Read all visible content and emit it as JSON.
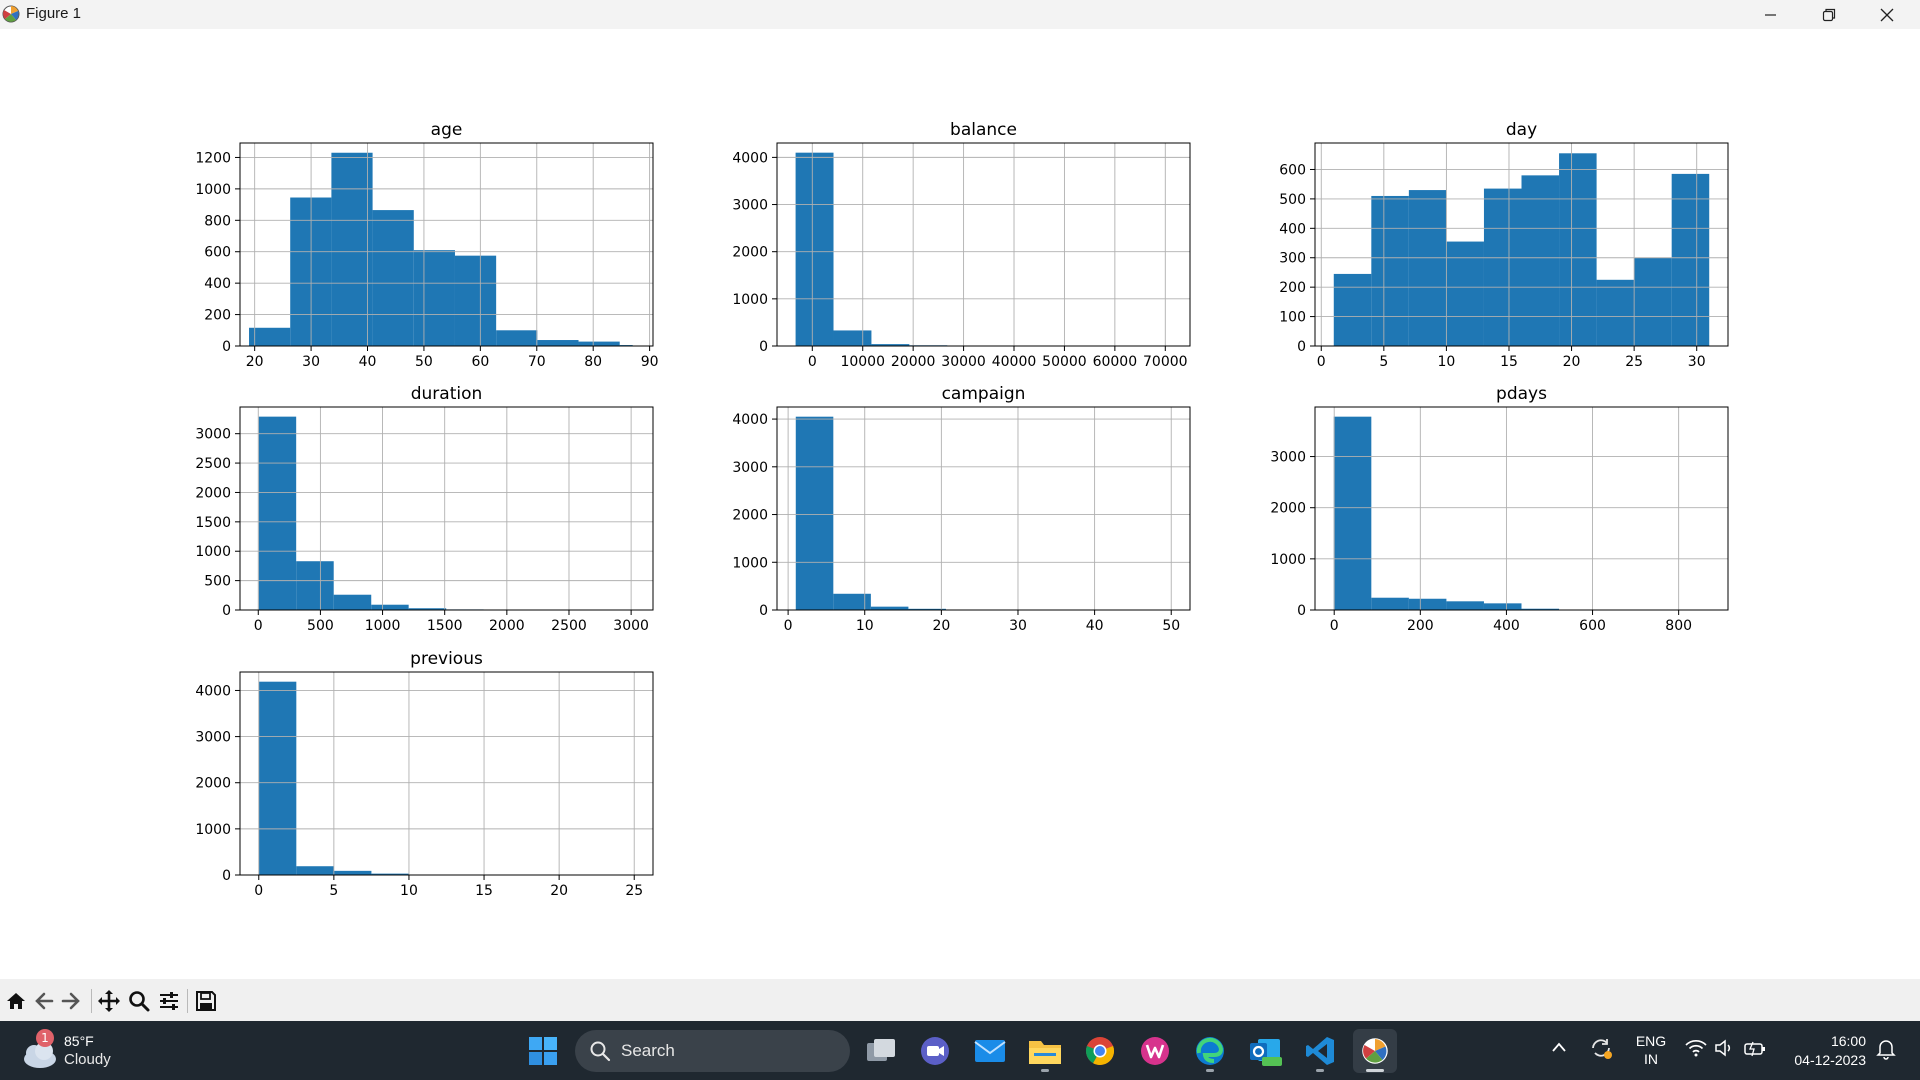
{
  "window": {
    "title": "Figure 1",
    "controls": [
      "minimize",
      "restore",
      "close"
    ]
  },
  "toolbar": {
    "buttons": [
      {
        "name": "home-icon"
      },
      {
        "name": "back-arrow-icon"
      },
      {
        "name": "forward-arrow-icon"
      },
      {
        "name": "pan-icon"
      },
      {
        "name": "zoom-icon"
      },
      {
        "name": "configure-subplots-icon"
      },
      {
        "name": "save-icon"
      }
    ]
  },
  "colors": {
    "bar": "#1f77b4",
    "grid": "#b0b0b0",
    "taskbar": "#1f2830"
  },
  "chart_data": [
    {
      "type": "bar",
      "title": "age",
      "bins": [
        [
          19,
          26.3
        ],
        [
          26.3,
          33.6
        ],
        [
          33.6,
          40.9
        ],
        [
          40.9,
          48.2
        ],
        [
          48.2,
          55.5
        ],
        [
          55.5,
          62.8
        ],
        [
          62.8,
          70.1
        ],
        [
          70.1,
          77.4
        ],
        [
          77.4,
          84.7
        ],
        [
          84.7,
          87
        ]
      ],
      "values": [
        116,
        945,
        1230,
        865,
        610,
        575,
        100,
        38,
        28,
        6
      ],
      "xticks": [
        20,
        30,
        40,
        50,
        60,
        70,
        80,
        90
      ],
      "yticks": [
        0,
        200,
        400,
        600,
        800,
        1000,
        1200
      ],
      "xlim": [
        17.4,
        90.6
      ],
      "ylim": [
        0,
        1292
      ],
      "grid": true
    },
    {
      "type": "bar",
      "title": "balance",
      "bins": [
        [
          -3313,
          4207
        ],
        [
          4207,
          11726
        ],
        [
          11726,
          19246
        ],
        [
          19246,
          26765
        ],
        [
          26765,
          34285
        ],
        [
          34285,
          41804
        ],
        [
          41804,
          49324
        ],
        [
          49324,
          56843
        ],
        [
          56843,
          64363
        ],
        [
          64363,
          71188
        ]
      ],
      "values": [
        4100,
        330,
        40,
        15,
        5,
        2,
        1,
        1,
        0,
        1
      ],
      "xticks": [
        0,
        10000,
        20000,
        30000,
        40000,
        50000,
        60000,
        70000
      ],
      "yticks": [
        0,
        1000,
        2000,
        3000,
        4000
      ],
      "xlim": [
        -7000,
        74900
      ],
      "ylim": [
        0,
        4305
      ],
      "grid": true
    },
    {
      "type": "bar",
      "title": "day",
      "bins": [
        [
          1,
          4
        ],
        [
          4,
          7
        ],
        [
          7,
          10
        ],
        [
          10,
          13
        ],
        [
          13,
          16
        ],
        [
          16,
          19
        ],
        [
          19,
          22
        ],
        [
          22,
          25
        ],
        [
          25,
          28
        ],
        [
          28,
          31
        ]
      ],
      "values": [
        245,
        510,
        530,
        355,
        535,
        580,
        655,
        225,
        300,
        585
      ],
      "xticks": [
        0,
        5,
        10,
        15,
        20,
        25,
        30
      ],
      "yticks": [
        0,
        100,
        200,
        300,
        400,
        500,
        600
      ],
      "xlim": [
        -0.5,
        32.5
      ],
      "ylim": [
        0,
        690
      ],
      "grid": true
    },
    {
      "type": "bar",
      "title": "duration",
      "bins": [
        [
          4,
          305
        ],
        [
          305,
          607
        ],
        [
          607,
          909
        ],
        [
          909,
          1210
        ],
        [
          1210,
          1512
        ],
        [
          1512,
          1813
        ],
        [
          1813,
          2115
        ],
        [
          2115,
          2416
        ],
        [
          2416,
          2718
        ],
        [
          2718,
          3025
        ]
      ],
      "values": [
        3290,
        830,
        260,
        90,
        30,
        10,
        4,
        1,
        0,
        1
      ],
      "xticks": [
        0,
        500,
        1000,
        1500,
        2000,
        2500,
        3000
      ],
      "yticks": [
        0,
        500,
        1000,
        1500,
        2000,
        2500,
        3000
      ],
      "xlim": [
        -147,
        3176
      ],
      "ylim": [
        0,
        3454
      ],
      "grid": true
    },
    {
      "type": "bar",
      "title": "campaign",
      "bins": [
        [
          1,
          5.9
        ],
        [
          5.9,
          10.8
        ],
        [
          10.8,
          15.7
        ],
        [
          15.7,
          20.6
        ],
        [
          20.6,
          25.5
        ],
        [
          25.5,
          30.4
        ],
        [
          30.4,
          35.3
        ],
        [
          35.3,
          40.2
        ],
        [
          40.2,
          45.1
        ],
        [
          45.1,
          50
        ]
      ],
      "values": [
        4050,
        340,
        70,
        25,
        10,
        5,
        2,
        0,
        0,
        1
      ],
      "xticks": [
        0,
        10,
        20,
        30,
        40,
        50
      ],
      "yticks": [
        0,
        1000,
        2000,
        3000,
        4000
      ],
      "xlim": [
        -1.45,
        52.45
      ],
      "ylim": [
        0,
        4253
      ],
      "grid": true
    },
    {
      "type": "bar",
      "title": "pdays",
      "bins": [
        [
          -1,
          86.2
        ],
        [
          86.2,
          173.4
        ],
        [
          173.4,
          260.6
        ],
        [
          260.6,
          347.8
        ],
        [
          347.8,
          435
        ],
        [
          435,
          522.2
        ],
        [
          522.2,
          609.4
        ],
        [
          609.4,
          696.6
        ],
        [
          696.6,
          783.8
        ],
        [
          783.8,
          871
        ]
      ],
      "values": [
        3780,
        240,
        220,
        170,
        130,
        25,
        5,
        3,
        2,
        2
      ],
      "xticks": [
        0,
        200,
        400,
        600,
        800
      ],
      "yticks": [
        0,
        1000,
        2000,
        3000
      ],
      "xlim": [
        -44.6,
        914.6
      ],
      "ylim": [
        0,
        3969
      ],
      "grid": true
    },
    {
      "type": "bar",
      "title": "previous",
      "bins": [
        [
          0,
          2.5
        ],
        [
          2.5,
          5
        ],
        [
          5,
          7.5
        ],
        [
          7.5,
          10
        ],
        [
          10,
          12.5
        ],
        [
          12.5,
          15
        ],
        [
          15,
          17.5
        ],
        [
          17.5,
          20
        ],
        [
          20,
          22.5
        ],
        [
          22.5,
          25
        ]
      ],
      "values": [
        4190,
        190,
        90,
        30,
        10,
        5,
        1,
        0,
        0,
        5
      ],
      "xticks": [
        0,
        5,
        10,
        15,
        20,
        25
      ],
      "yticks": [
        0,
        1000,
        2000,
        3000,
        4000
      ],
      "xlim": [
        -1.25,
        26.25
      ],
      "ylim": [
        0,
        4400
      ],
      "grid": true
    }
  ],
  "taskbar": {
    "weather": {
      "badge": "1",
      "temp": "85°F",
      "condition": "Cloudy"
    },
    "search_label": "Search",
    "apps": [
      {
        "name": "start-button-icon"
      },
      {
        "name": "search-bar"
      },
      {
        "name": "task-view-icon"
      },
      {
        "name": "teams-icon"
      },
      {
        "name": "mail-icon"
      },
      {
        "name": "file-explorer-icon"
      },
      {
        "name": "chrome-icon"
      },
      {
        "name": "wps-office-icon"
      },
      {
        "name": "edge-icon"
      },
      {
        "name": "outlook-new-icon"
      },
      {
        "name": "vscode-icon"
      },
      {
        "name": "matplotlib-figure-icon"
      }
    ],
    "tray": {
      "language_line1": "ENG",
      "language_line2": "IN",
      "time": "16:00",
      "date": "04-12-2023"
    }
  }
}
